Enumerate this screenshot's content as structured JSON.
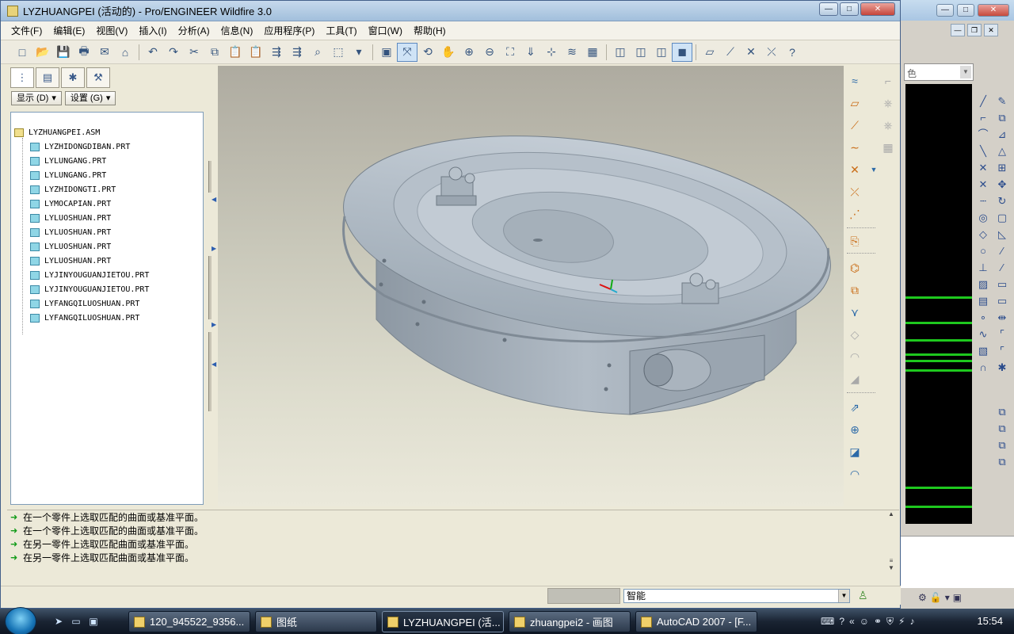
{
  "main_window": {
    "title": "LYZHUANGPEI (活动的) - Pro/ENGINEER Wildfire 3.0",
    "controls": {
      "minimize": "—",
      "maximize": "□",
      "close": "✕"
    }
  },
  "menu": [
    {
      "label": "文件(F)"
    },
    {
      "label": "编辑(E)"
    },
    {
      "label": "视图(V)"
    },
    {
      "label": "插入(I)"
    },
    {
      "label": "分析(A)"
    },
    {
      "label": "信息(N)"
    },
    {
      "label": "应用程序(P)"
    },
    {
      "label": "工具(T)"
    },
    {
      "label": "窗口(W)"
    },
    {
      "label": "帮助(H)"
    }
  ],
  "left_panel": {
    "show_button": "显示 (D)",
    "settings_button": "设置 (G)",
    "tree_root": "LYZHUANGPEI.ASM",
    "tree_items": [
      "LYZHIDONGDIBAN.PRT",
      "LYLUNGANG.PRT",
      "LYLUNGANG.PRT",
      "LYZHIDONGTI.PRT",
      "LYMOCAPIAN.PRT",
      "LYLUOSHUAN.PRT",
      "LYLUOSHUAN.PRT",
      "LYLUOSHUAN.PRT",
      "LYLUOSHUAN.PRT",
      "LYJINYOUGUANJIETOU.PRT",
      "LYJINYOUGUANJIETOU.PRT",
      "LYFANGQILUOSHUAN.PRT",
      "LYFANGQILUOSHUAN.PRT"
    ]
  },
  "messages": [
    "在一个零件上选取匹配的曲面或基准平面。",
    "在一个零件上选取匹配的曲面或基准平面。",
    "在另一零件上选取匹配曲面或基准平面。",
    "在另一零件上选取匹配曲面或基准平面。"
  ],
  "status": {
    "filter_value": "智能"
  },
  "background_window": {
    "layer_value": "色"
  },
  "taskbar": {
    "items": [
      {
        "label": "120_945522_9356..."
      },
      {
        "label": "图纸"
      },
      {
        "label": "LYZHUANGPEI (活..."
      },
      {
        "label": "zhuangpei2 - 画图"
      },
      {
        "label": "AutoCAD 2007 - [F..."
      }
    ],
    "clock": "15:54"
  },
  "colors": {
    "model": "#a9b4bf",
    "accent_green": "#1ec81e",
    "message_arrow": "#139c1a"
  }
}
